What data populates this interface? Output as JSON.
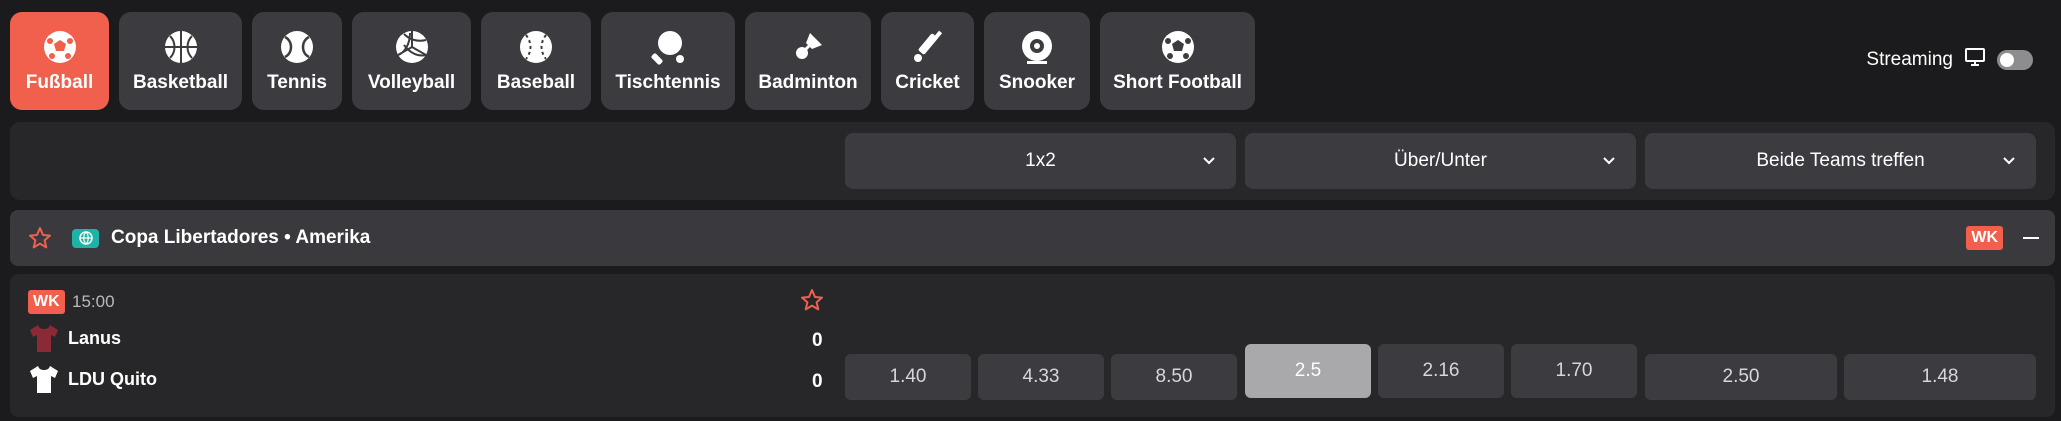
{
  "sports": [
    {
      "label": "Fußball",
      "icon": "soccer-ball-icon",
      "active": true
    },
    {
      "label": "Basketball",
      "icon": "basketball-icon",
      "active": false
    },
    {
      "label": "Tennis",
      "icon": "tennis-ball-icon",
      "active": false
    },
    {
      "label": "Volleyball",
      "icon": "volleyball-icon",
      "active": false
    },
    {
      "label": "Baseball",
      "icon": "baseball-icon",
      "active": false
    },
    {
      "label": "Tischtennis",
      "icon": "table-tennis-paddle-icon",
      "active": false
    },
    {
      "label": "Badminton",
      "icon": "shuttlecock-icon",
      "active": false
    },
    {
      "label": "Cricket",
      "icon": "cricket-bat-icon",
      "active": false
    },
    {
      "label": "Snooker",
      "icon": "snooker-ball-icon",
      "active": false
    },
    {
      "label": "Short Football",
      "icon": "soccer-ball-icon",
      "active": false
    }
  ],
  "streaming": {
    "label": "Streaming",
    "icon": "monitor-icon",
    "enabled": false
  },
  "markets": [
    {
      "label": "1x2"
    },
    {
      "label": "Über/Unter"
    },
    {
      "label": "Beide Teams treffen"
    }
  ],
  "league": {
    "name": "Copa Libertadores • Amerika",
    "badge": "WK",
    "star_icon": "star-icon",
    "region_icon": "globe-icon"
  },
  "event": {
    "badge": "WK",
    "time": "15:00",
    "home": {
      "name": "Lanus",
      "score": "0",
      "jersey_color": "#8a2a35"
    },
    "away": {
      "name": "LDU Quito",
      "score": "0",
      "jersey_color": "#ffffff"
    },
    "odds": [
      {
        "value": "1.40",
        "selected": false
      },
      {
        "value": "4.33",
        "selected": false
      },
      {
        "value": "8.50",
        "selected": false
      },
      {
        "value": "2.5",
        "selected": true
      },
      {
        "value": "2.16",
        "selected": false
      },
      {
        "value": "1.70",
        "selected": false
      },
      {
        "value": "2.50",
        "selected": false
      },
      {
        "value": "1.48",
        "selected": false
      }
    ]
  },
  "colors": {
    "accent": "#f0604d",
    "background": "#1b1b1d",
    "panel": "#27272a",
    "button": "#3c3c40",
    "region": "#1fb2a8"
  }
}
